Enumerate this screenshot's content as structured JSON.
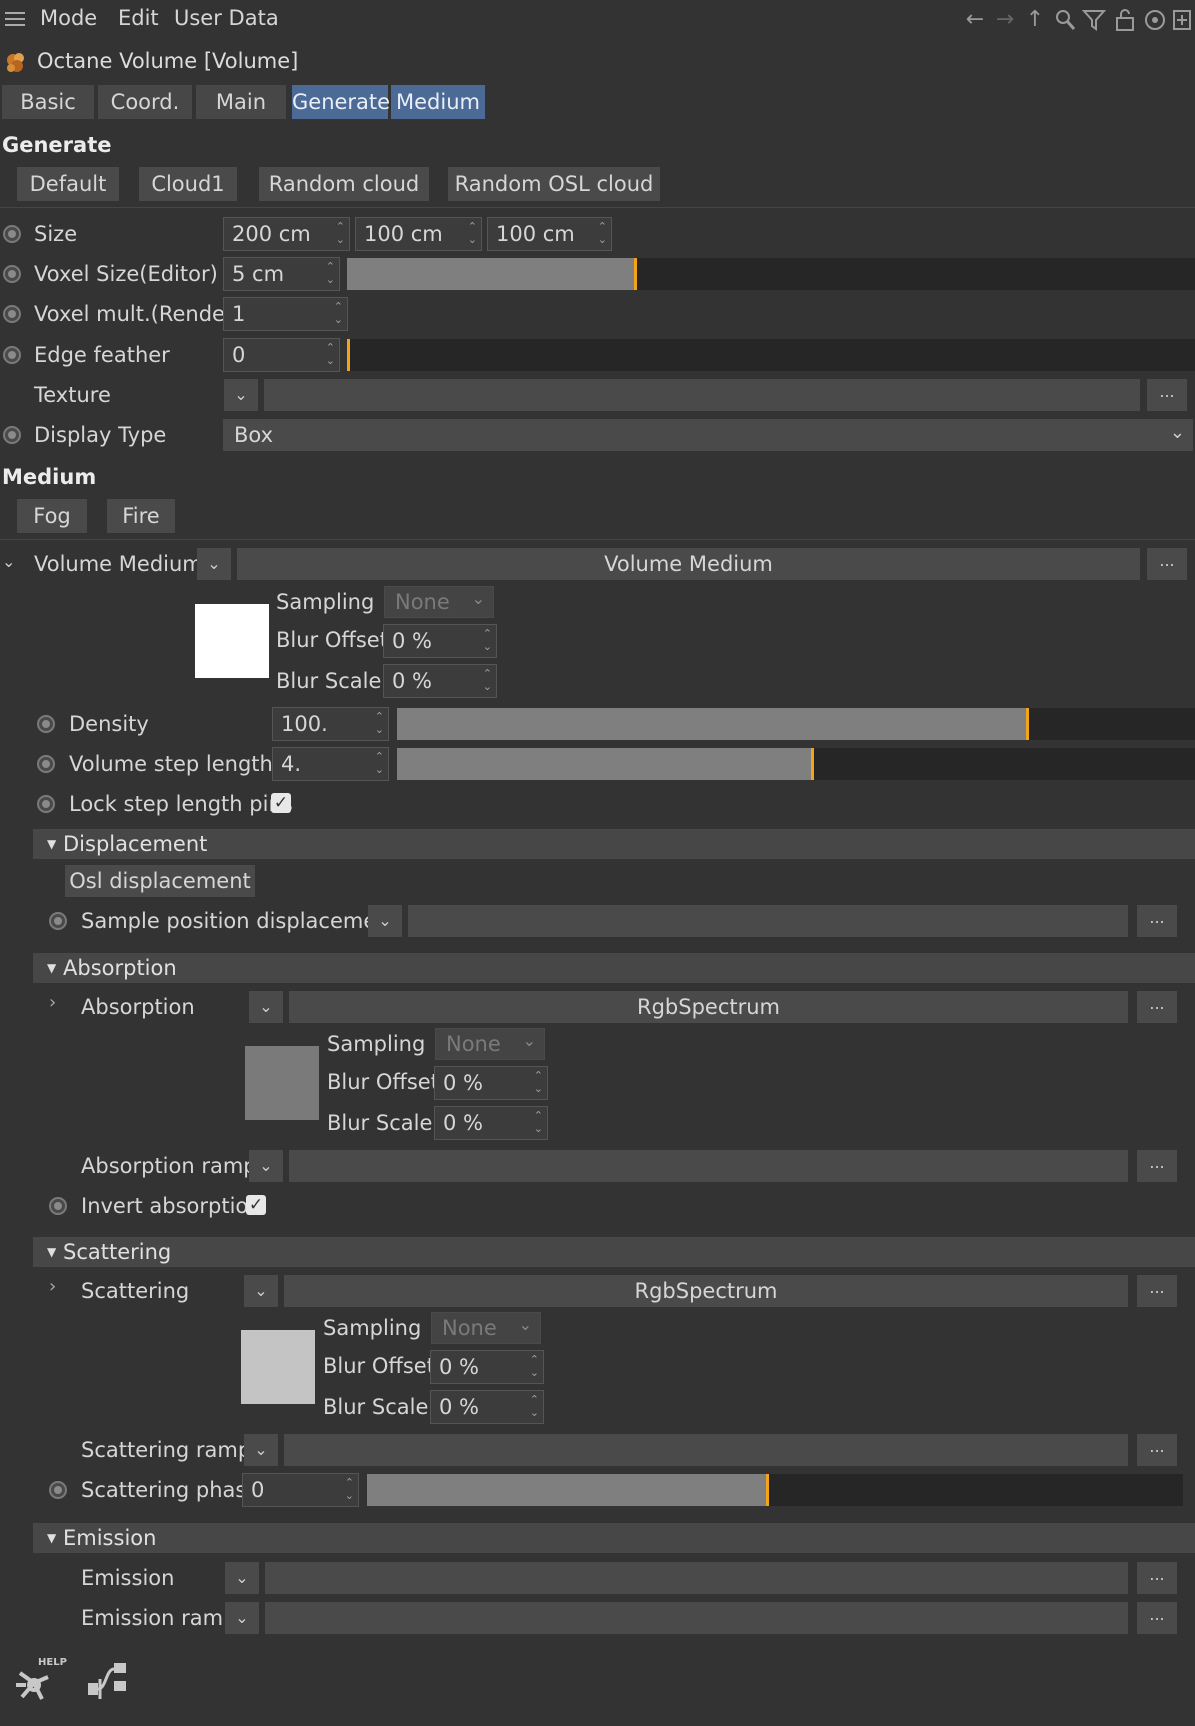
{
  "menu": {
    "mode": "Mode",
    "edit": "Edit",
    "user_data": "User Data"
  },
  "title": "Octane Volume [Volume]",
  "tabs": [
    {
      "label": "Basic",
      "active": false
    },
    {
      "label": "Coord.",
      "active": false
    },
    {
      "label": "Main",
      "active": false
    },
    {
      "label": "Generate",
      "active": true
    },
    {
      "label": "Medium",
      "active": true
    }
  ],
  "generate": {
    "heading": "Generate",
    "presets": [
      "Default",
      "Cloud1",
      "Random cloud",
      "Random OSL cloud"
    ],
    "size_label": "Size",
    "size_x": "200 cm",
    "size_y": "100 cm",
    "size_z": "100 cm",
    "voxel_size_label": "Voxel Size(Editor)",
    "voxel_size": "5 cm",
    "voxel_size_level": 0.34,
    "voxel_mult_label": "Voxel mult.(Render)",
    "voxel_mult": "1",
    "edge_feather_label": "Edge feather",
    "edge_feather": "0",
    "edge_feather_level": 0.0,
    "texture_label": "Texture",
    "display_type_label": "Display Type",
    "display_type": "Box"
  },
  "medium": {
    "heading": "Medium",
    "presets": [
      "Fog",
      "Fire"
    ],
    "volume_medium_label": "Volume Medium",
    "volume_medium_value": "Volume Medium",
    "sampling_label": "Sampling",
    "sampling": "None",
    "blur_offset_label": "Blur Offset",
    "blur_offset": "0 %",
    "blur_scale_label": "Blur Scale",
    "blur_scale": "0 %",
    "density_label": "Density",
    "density": "100.",
    "density_level": 0.79,
    "volume_step_label": "Volume step length",
    "volume_step": "4.",
    "volume_step_level": 0.52,
    "lock_step_label": "Lock step length pins",
    "lock_step_checked": true
  },
  "displacement": {
    "header": "Displacement",
    "osl_button": "Osl displacement",
    "sample_pos_label": "Sample position displacement"
  },
  "absorption": {
    "header": "Absorption",
    "label": "Absorption",
    "value": "RgbSpectrum",
    "sampling_label": "Sampling",
    "sampling": "None",
    "blur_offset_label": "Blur Offset",
    "blur_offset": "0 %",
    "blur_scale_label": "Blur Scale",
    "blur_scale": "0 %",
    "ramp_label": "Absorption ramp",
    "invert_label": "Invert absorption",
    "invert_checked": true,
    "swatch_color": "#7a7a7a"
  },
  "scattering": {
    "header": "Scattering",
    "label": "Scattering",
    "value": "RgbSpectrum",
    "sampling_label": "Sampling",
    "sampling": "None",
    "blur_offset_label": "Blur Offset",
    "blur_offset": "0 %",
    "blur_scale_label": "Blur Scale",
    "blur_scale": "0 %",
    "ramp_label": "Scattering ramp",
    "phase_label": "Scattering phase",
    "phase": "0",
    "phase_level": 0.49,
    "swatch_color": "#c4c4c4"
  },
  "emission": {
    "header": "Emission",
    "emission_label": "Emission",
    "ramp_label": "Emission ramp"
  },
  "footer": {
    "help_label": "HELP"
  },
  "colors": {
    "accent": "#f2a51a",
    "tab_active": "#4b6a96"
  },
  "more_label": "..."
}
